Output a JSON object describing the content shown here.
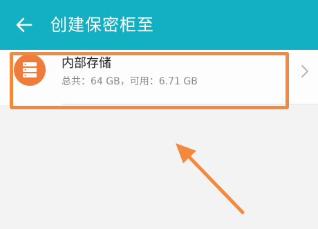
{
  "header": {
    "title": "创建保密柜至",
    "back_icon": "arrow-left-icon",
    "background_color": "#13afc3"
  },
  "storage_item": {
    "name": "内部存储",
    "detail": "总共：64 GB，可用：6.71 GB",
    "icon": "storage-icon",
    "chevron_icon": "chevron-right-icon",
    "icon_color": "#f07c3c"
  },
  "annotation": {
    "highlight_color": "#f2893d",
    "arrow_icon": "pointing-arrow-icon"
  }
}
